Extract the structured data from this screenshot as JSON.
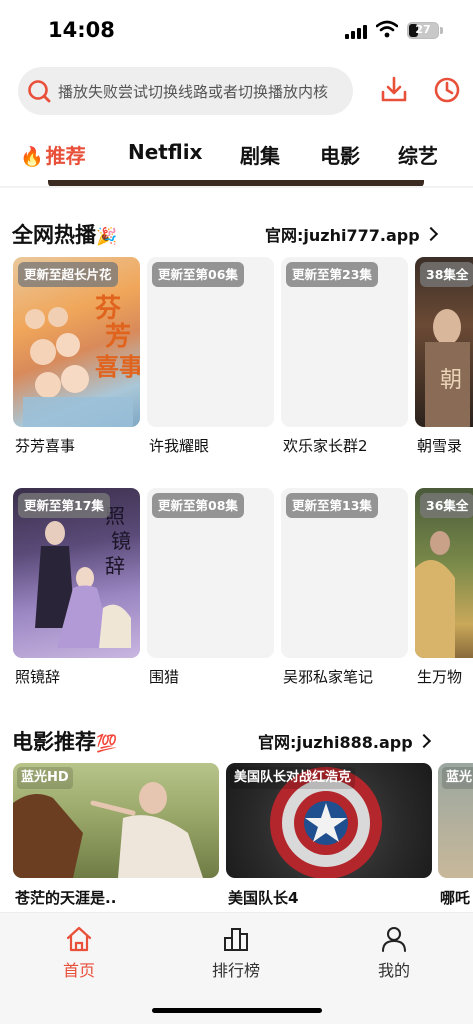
{
  "status_bar": {
    "time": "14:08",
    "battery": "27"
  },
  "search": {
    "placeholder": "播放失败尝试切换线路或者切换播放内核"
  },
  "header_icons": {
    "download": "download-icon",
    "history": "clock-icon"
  },
  "tabs": [
    {
      "label": "推荐",
      "active": true,
      "icon": "🔥"
    },
    {
      "label": "Netflix",
      "active": false
    },
    {
      "label": "剧集",
      "active": false
    },
    {
      "label": "电影",
      "active": false
    },
    {
      "label": "综艺",
      "active": false
    }
  ],
  "section_hot": {
    "title": "全网热播",
    "emoji": "🎉",
    "link": "官网:juzhi777.app",
    "row1": [
      {
        "badge": "更新至超长片花",
        "title": "芬芳喜事"
      },
      {
        "badge": "更新至第06集",
        "title": "许我耀眼"
      },
      {
        "badge": "更新至第23集",
        "title": "欢乐家长群2"
      },
      {
        "badge": "38集全",
        "title": "朝雪录"
      }
    ],
    "row2": [
      {
        "badge": "更新至第17集",
        "title": "照镜辞"
      },
      {
        "badge": "更新至第08集",
        "title": "围猎"
      },
      {
        "badge": "更新至第13集",
        "title": "吴邪私家笔记"
      },
      {
        "badge": "36集全",
        "title": "生万物"
      }
    ]
  },
  "section_movie": {
    "title": "电影推荐",
    "emoji": "💯",
    "link": "官网:juzhi888.app",
    "items": [
      {
        "badge": "蓝光HD",
        "title": "苍茫的天涯是.."
      },
      {
        "badge": "美国队长对战红浩克",
        "title": "美国队长4"
      },
      {
        "badge": "蓝光",
        "title": "哪吒"
      }
    ]
  },
  "bottom_nav": [
    {
      "label": "首页",
      "icon": "home-icon",
      "active": true
    },
    {
      "label": "排行榜",
      "icon": "ranking-icon",
      "active": false
    },
    {
      "label": "我的",
      "icon": "profile-icon",
      "active": false
    }
  ],
  "colors": {
    "accent": "#e8503a"
  }
}
